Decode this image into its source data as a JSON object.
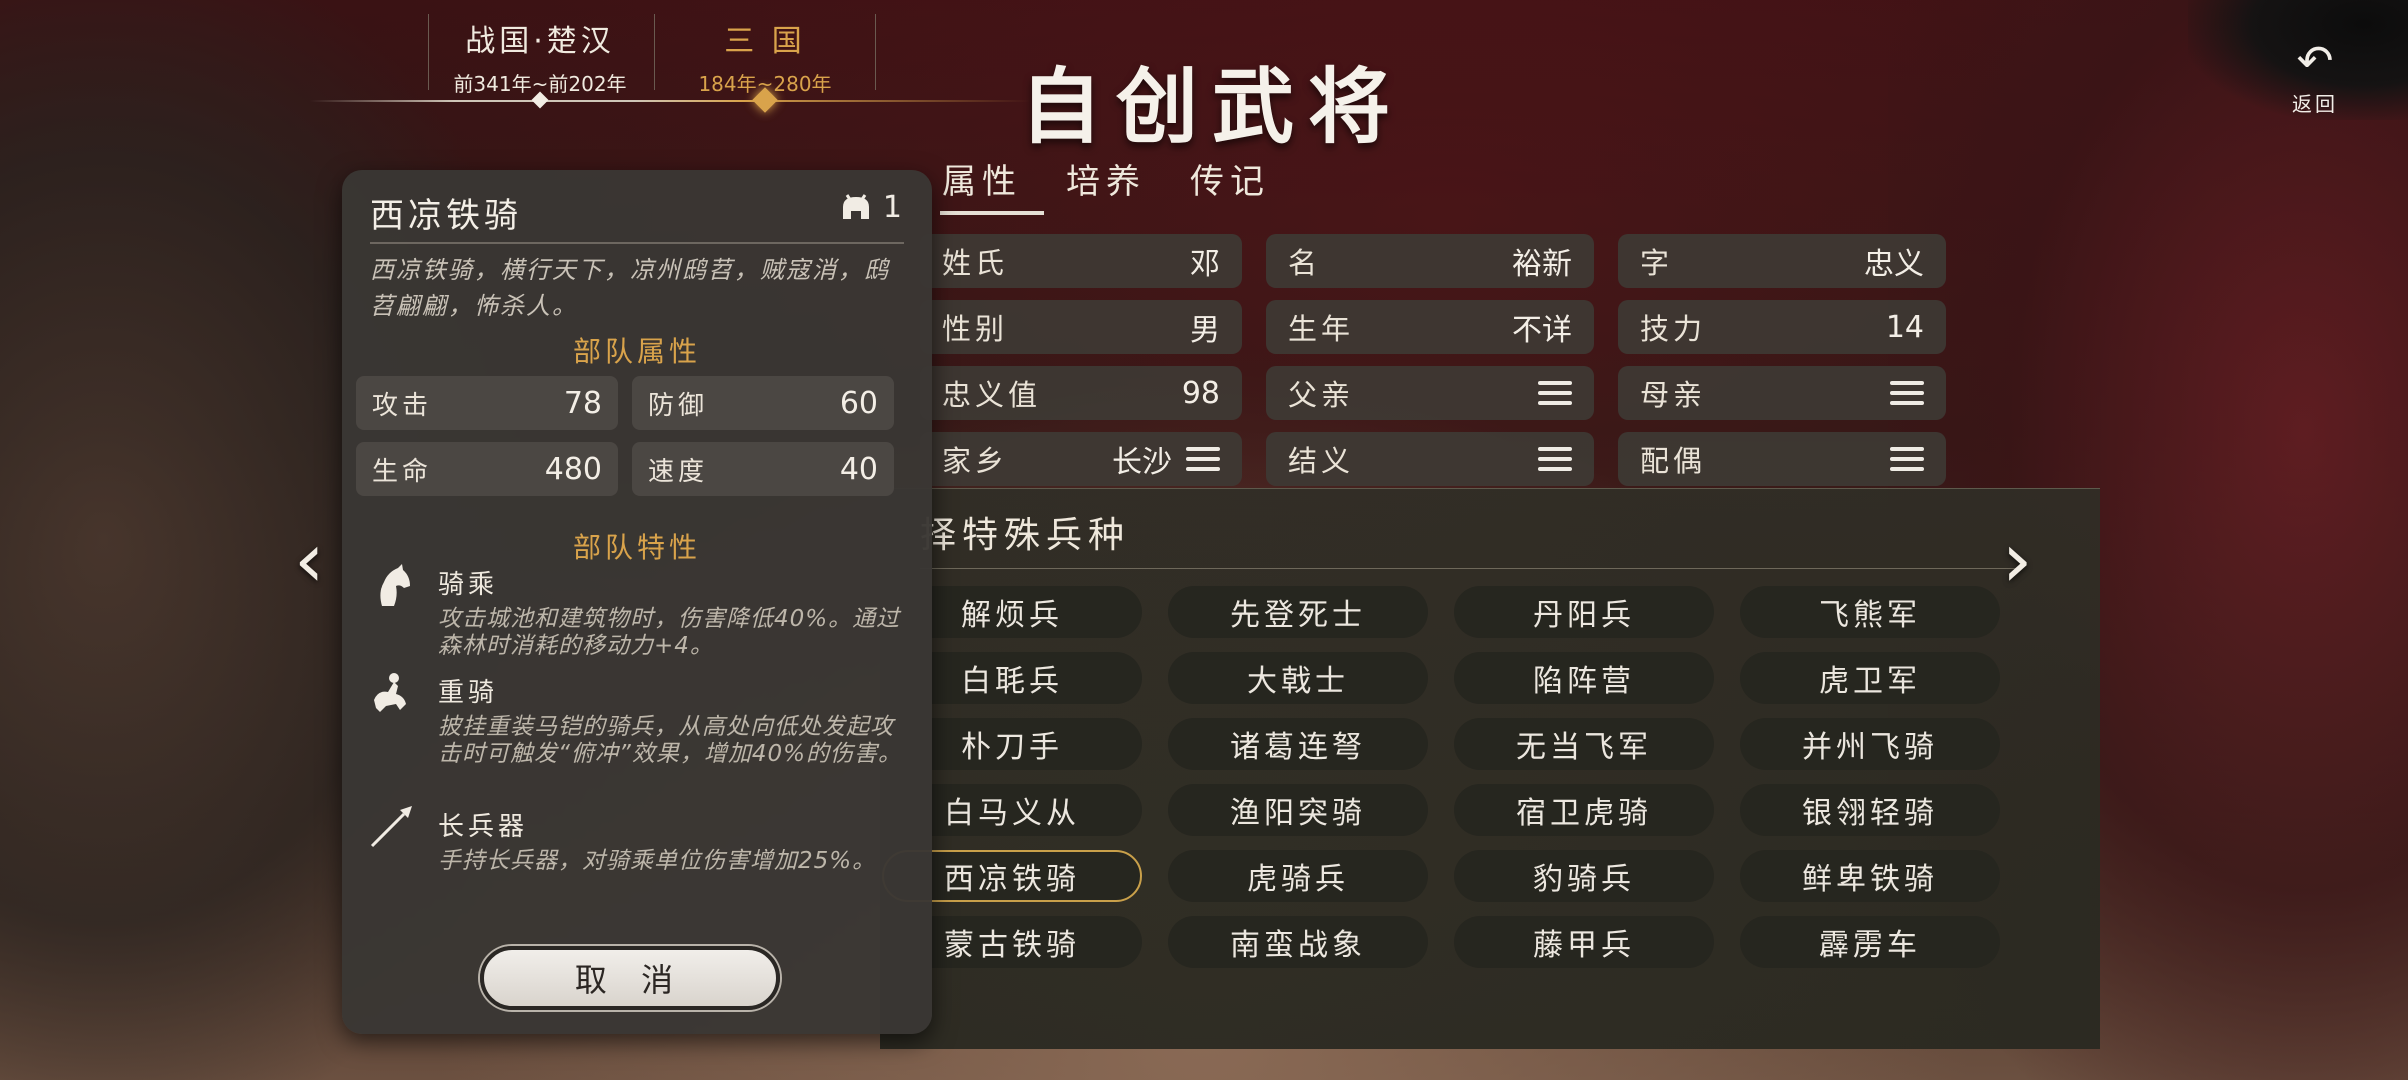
{
  "header": {
    "title": "自创武将",
    "back_label": "返回",
    "eras": [
      {
        "name": "战国·楚汉",
        "years": "前341年~前202年"
      },
      {
        "name": "三 国",
        "years": "184年~280年"
      }
    ]
  },
  "tabs": [
    {
      "label": "属性"
    },
    {
      "label": "培养"
    },
    {
      "label": "传记"
    }
  ],
  "attributes": {
    "surname": {
      "label": "姓氏",
      "value": "邓"
    },
    "given_name": {
      "label": "名",
      "value": "裕新"
    },
    "courtesy_name": {
      "label": "字",
      "value": "忠义"
    },
    "gender": {
      "label": "性别",
      "value": "男"
    },
    "birth_year": {
      "label": "生年",
      "value": "不详"
    },
    "skill_points": {
      "label": "技力",
      "value": "14"
    },
    "loyalty": {
      "label": "忠义值",
      "value": "98"
    },
    "father": {
      "label": "父亲"
    },
    "mother": {
      "label": "母亲"
    },
    "hometown": {
      "label": "家乡",
      "value": "长沙"
    },
    "sworn": {
      "label": "结义"
    },
    "spouse": {
      "label": "配偶"
    }
  },
  "troop_select": {
    "title": "择特殊兵种",
    "selected": "西凉铁骑",
    "rows": [
      [
        "解烦兵",
        "先登死士",
        "丹阳兵",
        "飞熊军"
      ],
      [
        "白毦兵",
        "大戟士",
        "陷阵营",
        "虎卫军"
      ],
      [
        "朴刀手",
        "诸葛连弩",
        "无当飞军",
        "并州飞骑"
      ],
      [
        "白马义从",
        "渔阳突骑",
        "宿卫虎骑",
        "银翎轻骑"
      ],
      [
        "西凉铁骑",
        "虎骑兵",
        "豹骑兵",
        "鲜卑铁骑"
      ],
      [
        "蒙古铁骑",
        "南蛮战象",
        "藤甲兵",
        "霹雳车"
      ]
    ]
  },
  "detail": {
    "title": "西凉铁骑",
    "count": "1",
    "description": "西凉铁骑，横行天下，凉州鸱苕，贼寇消，鸱苕翩翩，怖杀人。",
    "stats_heading": "部队属性",
    "stats": {
      "attack": {
        "label": "攻击",
        "value": "78"
      },
      "defense": {
        "label": "防御",
        "value": "60"
      },
      "hp": {
        "label": "生命",
        "value": "480"
      },
      "speed": {
        "label": "速度",
        "value": "40"
      }
    },
    "traits_heading": "部队特性",
    "traits": [
      {
        "icon": "horse-head-icon",
        "name": "骑乘",
        "desc": "攻击城池和建筑物时，伤害降低40%。通过森林时消耗的移动力+4。"
      },
      {
        "icon": "armored-cavalry-icon",
        "name": "重骑",
        "desc": "披挂重装马铠的骑兵，从高处向低处发起攻击时可触发“俯冲”效果，增加40%的伤害。"
      },
      {
        "icon": "spear-icon",
        "name": "长兵器",
        "desc": "手持长兵器，对骑乘单位伤害增加25%。"
      }
    ],
    "cancel_label": "取 消"
  },
  "colors": {
    "accent_gold": "#d9a34b",
    "panel_dark": "#3a3734",
    "field_bg": "#3e3a34"
  }
}
